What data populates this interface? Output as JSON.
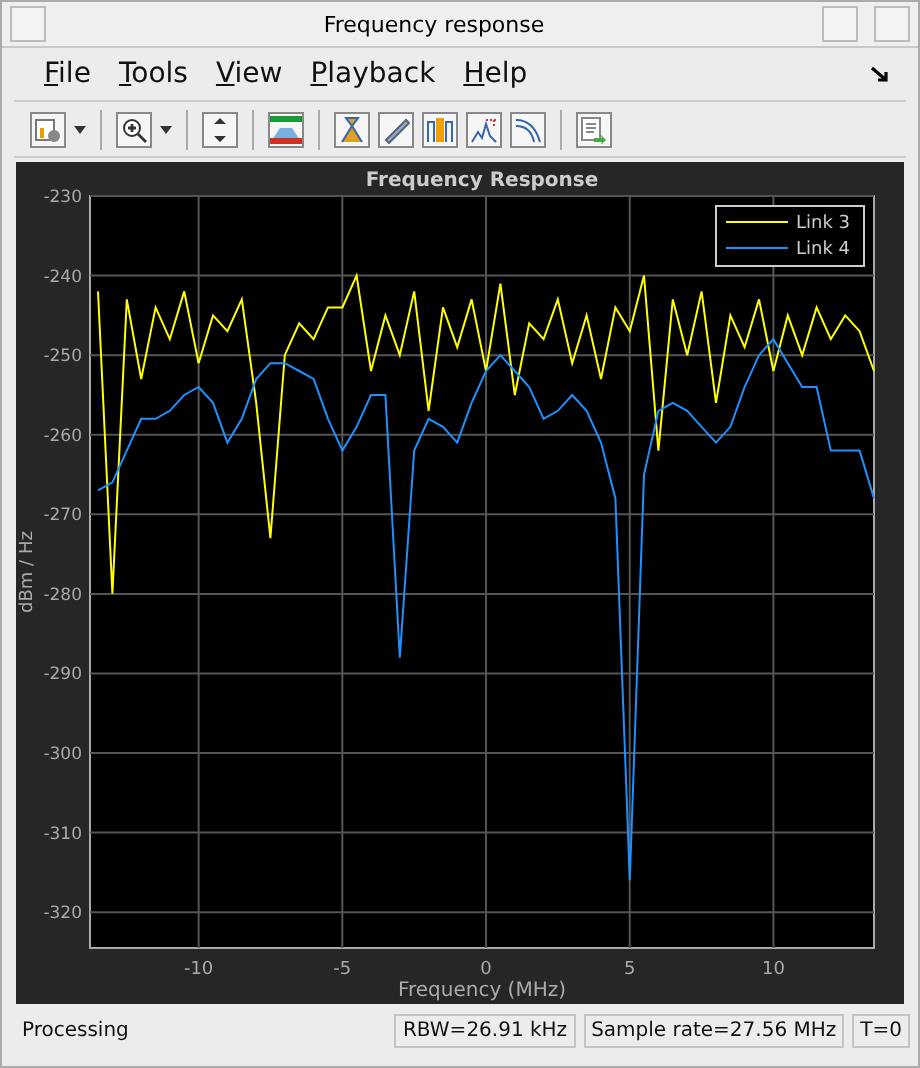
{
  "window": {
    "title": "Frequency response"
  },
  "menu": [
    {
      "label": "File"
    },
    {
      "label": "Tools"
    },
    {
      "label": "View"
    },
    {
      "label": "Playback"
    },
    {
      "label": "Help"
    }
  ],
  "plot": {
    "chart_data": {
      "type": "line",
      "title": "Frequency Response",
      "xlabel": "Frequency (MHz)",
      "ylabel": "dBm / Hz",
      "x": [
        -13.5,
        -13,
        -12.5,
        -12,
        -11.5,
        -11,
        -10.5,
        -10,
        -9.5,
        -9,
        -8.5,
        -8,
        -7.5,
        -7,
        -6.5,
        -6,
        -5.5,
        -5,
        -4.5,
        -4,
        -3.5,
        -3,
        -2.5,
        -2,
        -1.5,
        -1,
        -0.5,
        0,
        0.5,
        1,
        1.5,
        2,
        2.5,
        3,
        3.5,
        4,
        4.5,
        5,
        5.5,
        6,
        6.5,
        7,
        7.5,
        8,
        8.5,
        9,
        9.5,
        10,
        10.5,
        11,
        11.5,
        12,
        12.5,
        13,
        13.5
      ],
      "series": [
        {
          "name": "Link 3",
          "color": "#ffff00",
          "values": [
            -242,
            -280,
            -243,
            -253,
            -244,
            -248,
            -242,
            -251,
            -245,
            -247,
            -243,
            -256,
            -273,
            -250,
            -246,
            -248,
            -244,
            -244,
            -240,
            -252,
            -245,
            -250,
            -242,
            -257,
            -244,
            -249,
            -243,
            -252,
            -241,
            -255,
            -246,
            -248,
            -243,
            -251,
            -245,
            -253,
            -244,
            -247,
            -240,
            -262,
            -243,
            -250,
            -242,
            -256,
            -245,
            -249,
            -243,
            -252,
            -245,
            -250,
            -244,
            -248,
            -245,
            -247,
            -252
          ]
        },
        {
          "name": "Link 4",
          "color": "#1e90ff",
          "values": [
            -267,
            -266,
            -262,
            -258,
            -258,
            -257,
            -255,
            -254,
            -256,
            -261,
            -258,
            -253,
            -251,
            -251,
            -252,
            -253,
            -258,
            -262,
            -259,
            -255,
            -255,
            -288,
            -262,
            -258,
            -259,
            -261,
            -256,
            -252,
            -250,
            -252,
            -254,
            -258,
            -257,
            -255,
            -257,
            -261,
            -268,
            -316,
            -265,
            -257,
            -256,
            -257,
            -259,
            -261,
            -259,
            -254,
            -250,
            -248,
            -251,
            -254,
            -254,
            -262,
            -262,
            -262,
            -268
          ]
        }
      ],
      "grid": true,
      "legend": true,
      "xlim": [
        -13.78,
        13.5
      ],
      "ylim": [
        -324.5,
        -230
      ],
      "xticks": [
        -10,
        -5,
        0,
        5,
        10
      ],
      "yticks": [
        -230,
        -240,
        -250,
        -260,
        -270,
        -280,
        -290,
        -300,
        -310,
        -320
      ]
    }
  },
  "status_bar": [
    {
      "text": "Processing"
    },
    {
      "text": "RBW=26.91 kHz"
    },
    {
      "text": "Sample rate=27.56 MHz"
    },
    {
      "text": "T=0"
    }
  ]
}
